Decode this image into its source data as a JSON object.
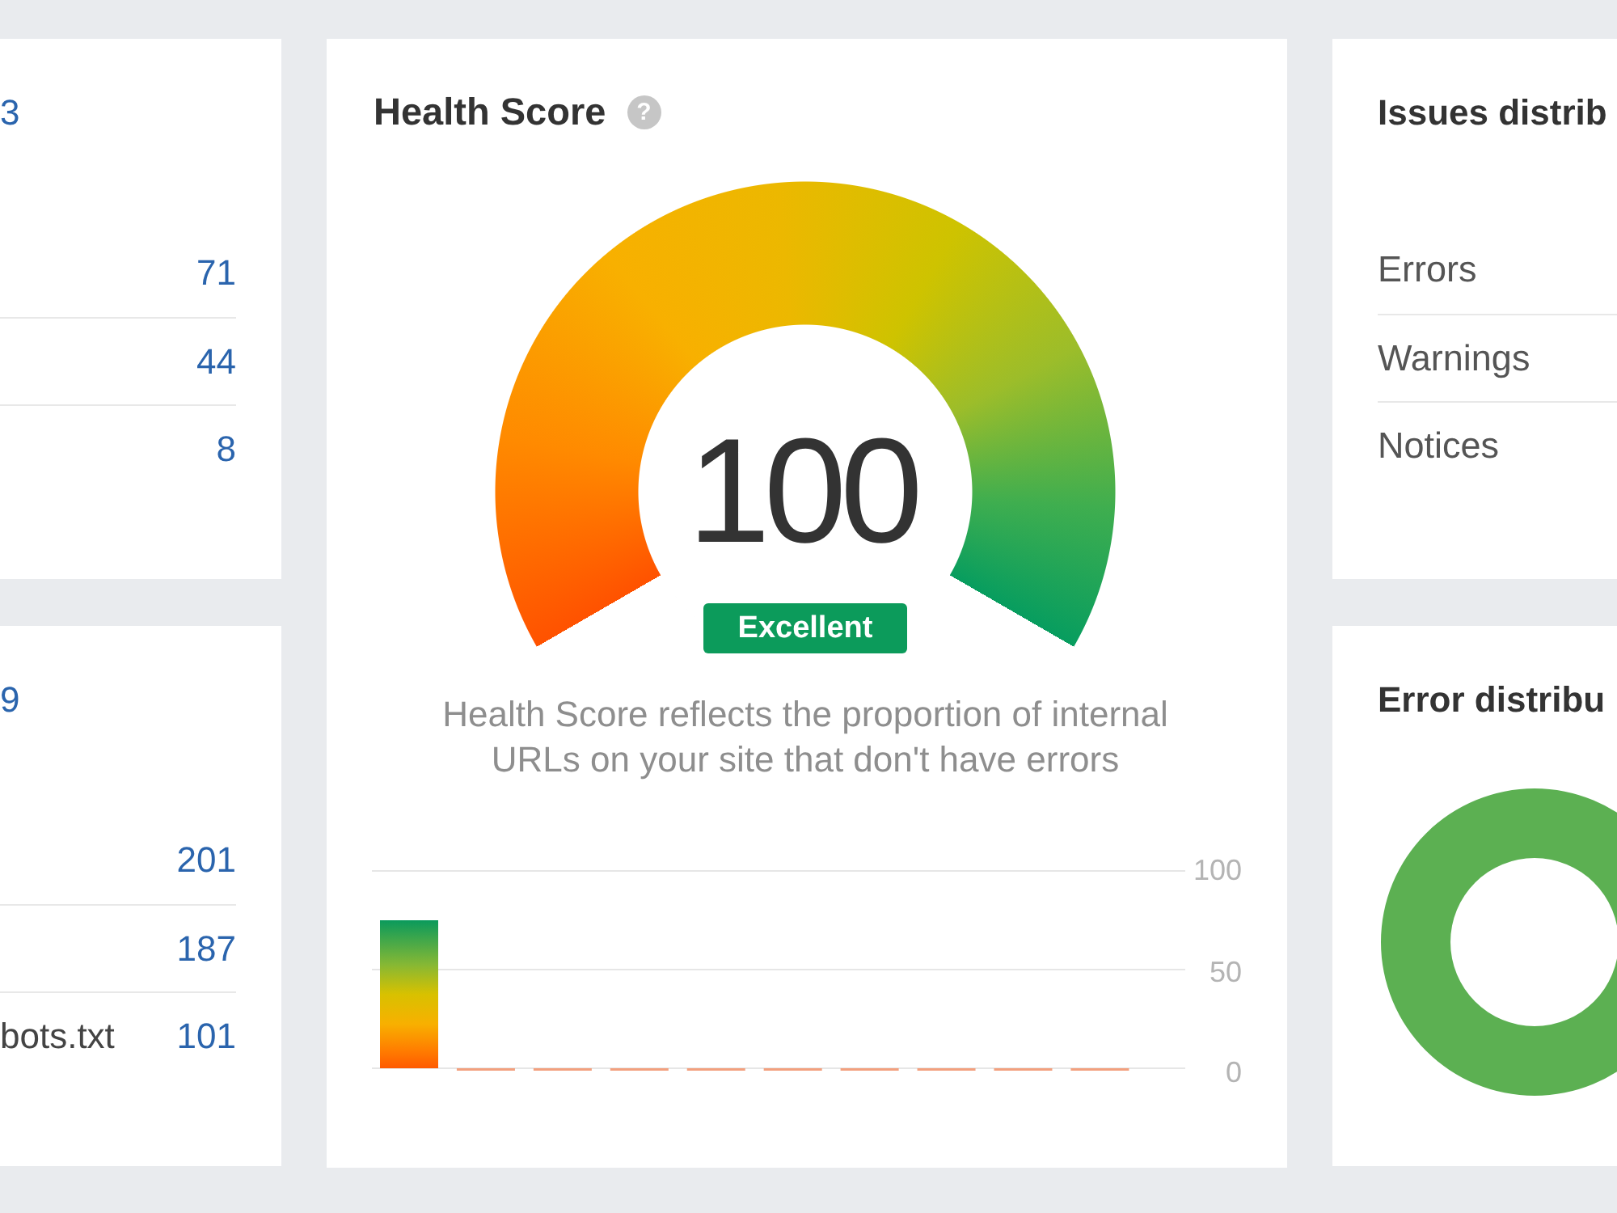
{
  "left_top_card": {
    "total": "3",
    "rows": [
      {
        "value": "71"
      },
      {
        "value": "44"
      },
      {
        "value": "8"
      }
    ]
  },
  "left_bottom_card": {
    "total": "9",
    "rows": [
      {
        "value": "201"
      },
      {
        "value": "187"
      },
      {
        "label": "bots.txt",
        "value": "101"
      }
    ]
  },
  "health_score_card": {
    "title": "Health Score",
    "help_icon": "?",
    "score": "100",
    "rating": "Excellent",
    "description": "Health Score reflects the proportion of internal URLs on your site that don't have errors",
    "chart_data": [
      {
        "type": "bar",
        "values": [
          75,
          0,
          0,
          0,
          0,
          0,
          0,
          0,
          0,
          0
        ],
        "ylim": [
          0,
          100
        ],
        "yticks": [
          0,
          50,
          100
        ],
        "grid": "y"
      }
    ]
  },
  "issues_card": {
    "title": "Issues distrib",
    "rows": [
      {
        "label": "Errors"
      },
      {
        "label": "Warnings"
      },
      {
        "label": "Notices"
      }
    ]
  },
  "error_distribution_card": {
    "title": "Error distribu"
  }
}
